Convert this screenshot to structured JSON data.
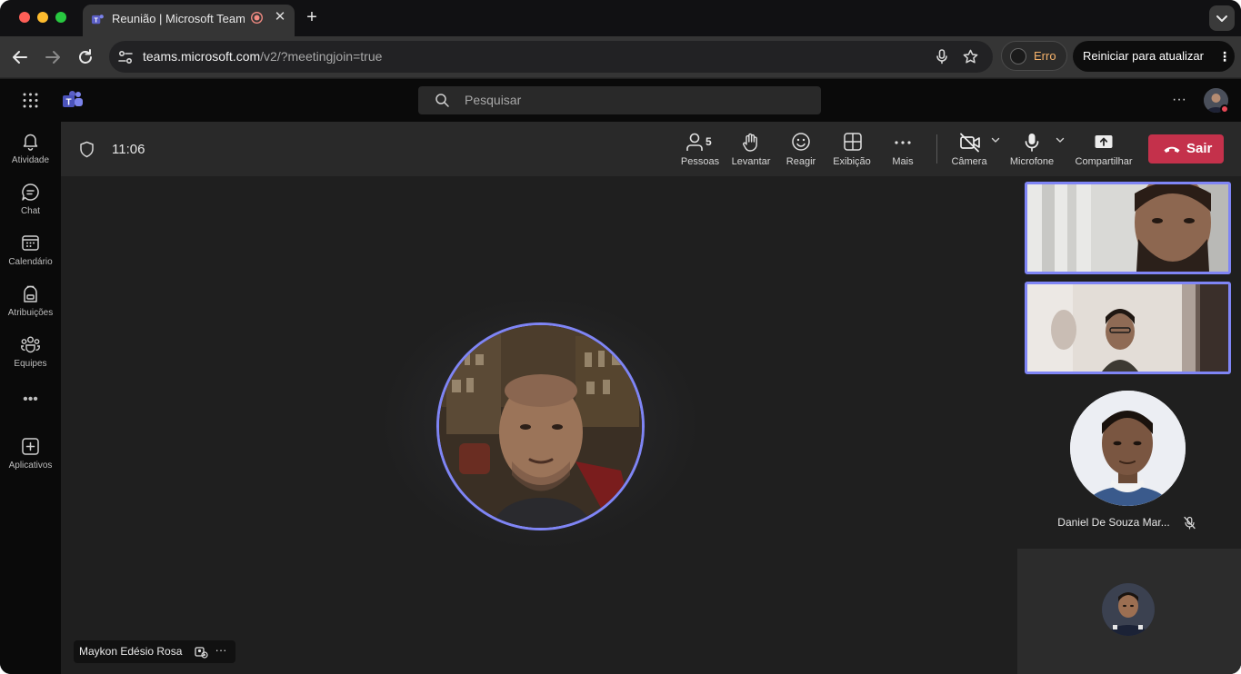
{
  "browser": {
    "tab_title": "Reunião | Microsoft Teams",
    "tab_close": "✕",
    "new_tab": "+",
    "url_host": "teams.microsoft.com",
    "url_path": "/v2/?meetingjoin=true",
    "profile_status": "Erro",
    "update_button": "Reiniciar para atualizar",
    "update_more": "⋮"
  },
  "teams_header": {
    "search_placeholder": "Pesquisar",
    "more": "···"
  },
  "rail": {
    "items": [
      {
        "label": "Atividade",
        "icon": "bell-icon"
      },
      {
        "label": "Chat",
        "icon": "chat-icon"
      },
      {
        "label": "Calendário",
        "icon": "calendar-icon"
      },
      {
        "label": "Atribuições",
        "icon": "backpack-icon"
      },
      {
        "label": "Equipes",
        "icon": "teams-icon"
      },
      {
        "label": "Aplicativos",
        "icon": "add-apps-icon"
      }
    ],
    "more": "•••"
  },
  "meeting": {
    "time": "11:06",
    "people_count": "5",
    "tools": {
      "people": "Pessoas",
      "raise": "Levantar",
      "react": "Reagir",
      "view": "Exibição",
      "more": "Mais",
      "camera": "Câmera",
      "mic": "Microfone",
      "share": "Compartilhar"
    },
    "leave": "Sair",
    "leave_color": "#c4314b",
    "accent": "#7f85f5"
  },
  "stage": {
    "speaker_name": "Maykon Edésio Rosa",
    "more": "···"
  },
  "gallery": {
    "participant_name": "Daniel De Souza Mar..."
  }
}
